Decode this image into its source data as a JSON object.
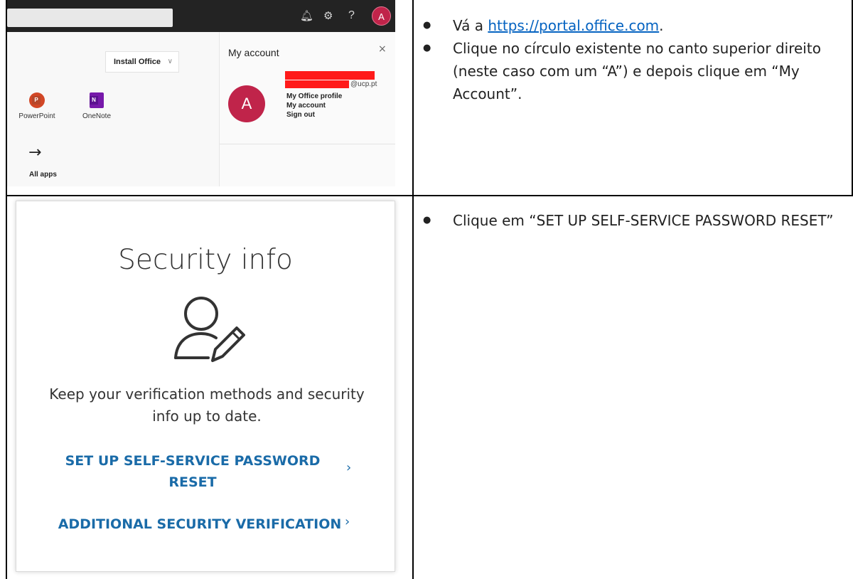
{
  "office_portal": {
    "install_office_label": "Install Office",
    "install_office_chevron": "∨",
    "apps": [
      {
        "name": "PowerPoint",
        "logo_letter": "P",
        "color": "#d24726"
      },
      {
        "name": "OneNote",
        "logo_letter": "N",
        "color": "#7719aa"
      }
    ],
    "all_apps_label": "All apps",
    "all_apps_arrow": "→",
    "topbar_icons": {
      "bell": "🔔︎",
      "gear": "⚙︎",
      "help": "?"
    },
    "avatar_letter": "A",
    "avatar_color": "#c0244a"
  },
  "account_panel": {
    "title": "My account",
    "close_glyph": "×",
    "avatar_letter": "A",
    "email_domain": "@ucp.pt",
    "links": [
      "My Office profile",
      "My account",
      "Sign out"
    ]
  },
  "security_info": {
    "title": "Security info",
    "description": "Keep your verification methods and security info up to date.",
    "setup_link": "SET UP SELF-SERVICE PASSWORD RESET",
    "additional_link": "ADDITIONAL SECURITY VERIFICATION",
    "chevron": "›",
    "link_color": "#1a6ba8"
  },
  "instructions": {
    "step1_prefix": "Vá a ",
    "step1_link": "https://portal.office.com",
    "step1_suffix": ".",
    "step2": "Clique no círculo existente no canto superior direito (neste caso com um “A”) e depois clique em “My Account”.",
    "step3": "Clique em “SET UP SELF-SERVICE PASSWORD RESET”"
  }
}
